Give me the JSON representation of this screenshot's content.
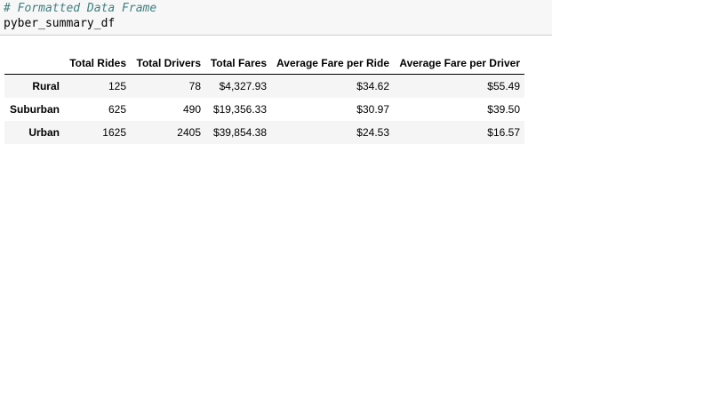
{
  "cell": {
    "comment": "# Formatted Data Frame",
    "code": "pyber_summary_df"
  },
  "table": {
    "index_header": "",
    "columns": [
      "Total Rides",
      "Total Drivers",
      "Total Fares",
      "Average Fare per Ride",
      "Average Fare per Driver"
    ],
    "rows": [
      {
        "index": "Rural",
        "values": [
          "125",
          "78",
          "$4,327.93",
          "$34.62",
          "$55.49"
        ]
      },
      {
        "index": "Suburban",
        "values": [
          "625",
          "490",
          "$19,356.33",
          "$30.97",
          "$39.50"
        ]
      },
      {
        "index": "Urban",
        "values": [
          "1625",
          "2405",
          "$39,854.38",
          "$24.53",
          "$16.57"
        ]
      }
    ]
  }
}
